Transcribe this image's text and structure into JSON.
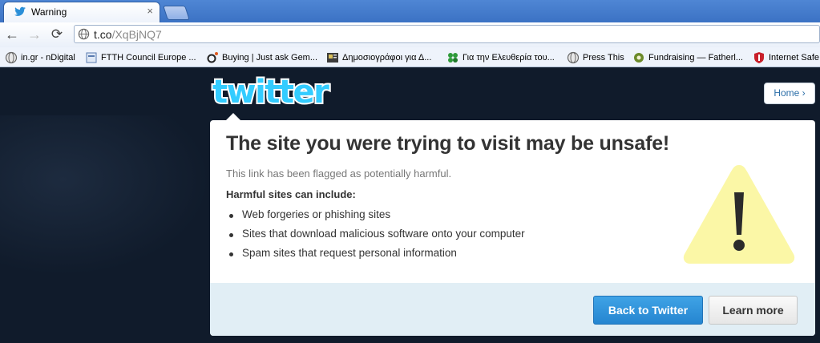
{
  "browser": {
    "tab": {
      "title": "Warning",
      "close_glyph": "×"
    },
    "nav": {
      "back": "←",
      "forward": "→",
      "reload": "⟳"
    },
    "omnibox": {
      "host": "t.co",
      "path": "/XqBjNQ7"
    },
    "bookmarks": [
      {
        "label": "in.gr - nDigital",
        "icon": "globe-icon"
      },
      {
        "label": "FTTH Council Europe ...",
        "icon": "page-icon"
      },
      {
        "label": "Buying | Just ask Gem...",
        "icon": "gem-icon"
      },
      {
        "label": "Δημοσιογράφοι για Δ...",
        "icon": "newspaper-icon"
      },
      {
        "label": "Για την Ελευθερία του...",
        "icon": "clover-icon"
      },
      {
        "label": "Press This",
        "icon": "globe-icon"
      },
      {
        "label": "Fundraising — Fatherl...",
        "icon": "flower-icon"
      },
      {
        "label": "Internet Safe",
        "icon": "shield-icon"
      }
    ]
  },
  "page": {
    "home_label": "Home ›",
    "headline": "The site you were trying to visit may be unsafe!",
    "subtitle": "This link has been flagged as potentially harmful.",
    "harmful_title": "Harmful sites can include:",
    "harmful_items": [
      "Web forgeries or phishing sites",
      "Sites that download malicious software onto your computer",
      "Spam sites that request personal information"
    ],
    "back_label": "Back to Twitter",
    "learn_label": "Learn more"
  },
  "colors": {
    "brand": "#33ccff",
    "primary_button": "#2585d0",
    "page_bg": "#101b2b",
    "warning_yellow": "#fbf7a6"
  }
}
